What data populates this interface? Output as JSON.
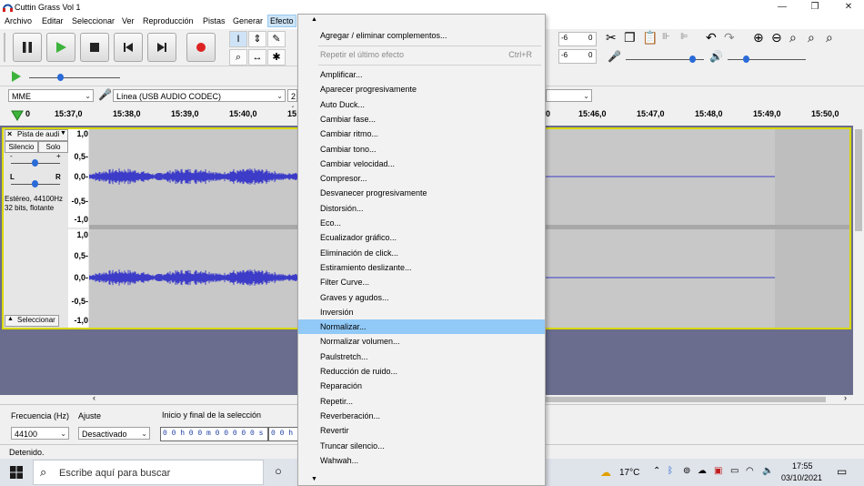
{
  "window": {
    "title": "Cuttin Grass Vol 1",
    "minimize": "—",
    "maximize": "❐",
    "close": "✕"
  },
  "menubar": [
    "Archivo",
    "Editar",
    "Seleccionar",
    "Ver",
    "Reproducción",
    "Pistas",
    "Generar",
    "Efecto"
  ],
  "device_toolbar": {
    "host": "MME",
    "input": "Línea (USB AUDIO  CODEC)",
    "channels": "2 (",
    "meter_left_scale": [
      "-6",
      "0"
    ],
    "meter_right_scale": [
      "-6",
      "0"
    ]
  },
  "timeline": {
    "ticks": [
      "15:37,0",
      "15:38,0",
      "15:39,0",
      "15:40,0",
      "15:4",
      "15:46,0",
      "15:47,0",
      "15:48,0",
      "15:49,0",
      "15:50,0"
    ],
    "edge_digit": "0"
  },
  "track": {
    "name": "Pista de audi",
    "mute": "Silencio",
    "solo": "Solo",
    "gain_minus": "-",
    "gain_plus": "+",
    "pan_left": "L",
    "pan_right": "R",
    "info_line1": "Estéreo, 44100Hz",
    "info_line2": "32 bits, flotante",
    "select": "Seleccionar",
    "scale_top": [
      "1,0",
      "0,5-",
      "0,0-",
      "-0,5-",
      "-1,0"
    ],
    "scale_bottom": [
      "1,0",
      "0,5-",
      "0,0-",
      "-0,5-",
      "-1,0"
    ]
  },
  "selection_toolbar": {
    "rate_label": "Frecuencia (Hz)",
    "snap_label": "Ajuste",
    "range_label": "Inicio y final de la selección",
    "rate_value": "44100",
    "snap_value": "Desactivado",
    "start_time": "0 0 h 0 0 m 0 0 0 0 0 s",
    "end_time_partial": "0 0 h 0"
  },
  "status": "Detenido.",
  "taskbar": {
    "search_placeholder": "Escribe aquí para buscar",
    "temperature": "17°C",
    "time": "17:55",
    "date": "03/10/2021"
  },
  "effect_menu": {
    "top": [
      {
        "label": "Agregar / eliminar complementos..."
      },
      {
        "label": "Repetir el último efecto",
        "shortcut": "Ctrl+R",
        "disabled": true
      }
    ],
    "items": [
      "Amplificar...",
      "Aparecer progresivamente",
      "Auto Duck...",
      "Cambiar fase...",
      "Cambiar ritmo...",
      "Cambiar tono...",
      "Cambiar velocidad...",
      "Compresor...",
      "Desvanecer progresivamente",
      "Distorsión...",
      "Eco...",
      "Ecualizador gráfico...",
      "Eliminación de click...",
      "Estiramiento deslizante...",
      "Filter Curve...",
      "Graves y agudos...",
      "Inversión",
      "Normalizar...",
      "Normalizar volumen...",
      "Paulstretch...",
      "Reducción de ruido...",
      "Reparación",
      "Repetir...",
      "Reverberación...",
      "Revertir",
      "Truncar silencio...",
      "Wahwah..."
    ],
    "highlighted": "Normalizar..."
  },
  "colors": {
    "waveform": "#3c3cc8",
    "track_border": "#d8d800",
    "track_background": "#6a6d8e",
    "menu_highlight": "#91c9f7",
    "play": "#3cb43c",
    "record": "#dd2222"
  }
}
